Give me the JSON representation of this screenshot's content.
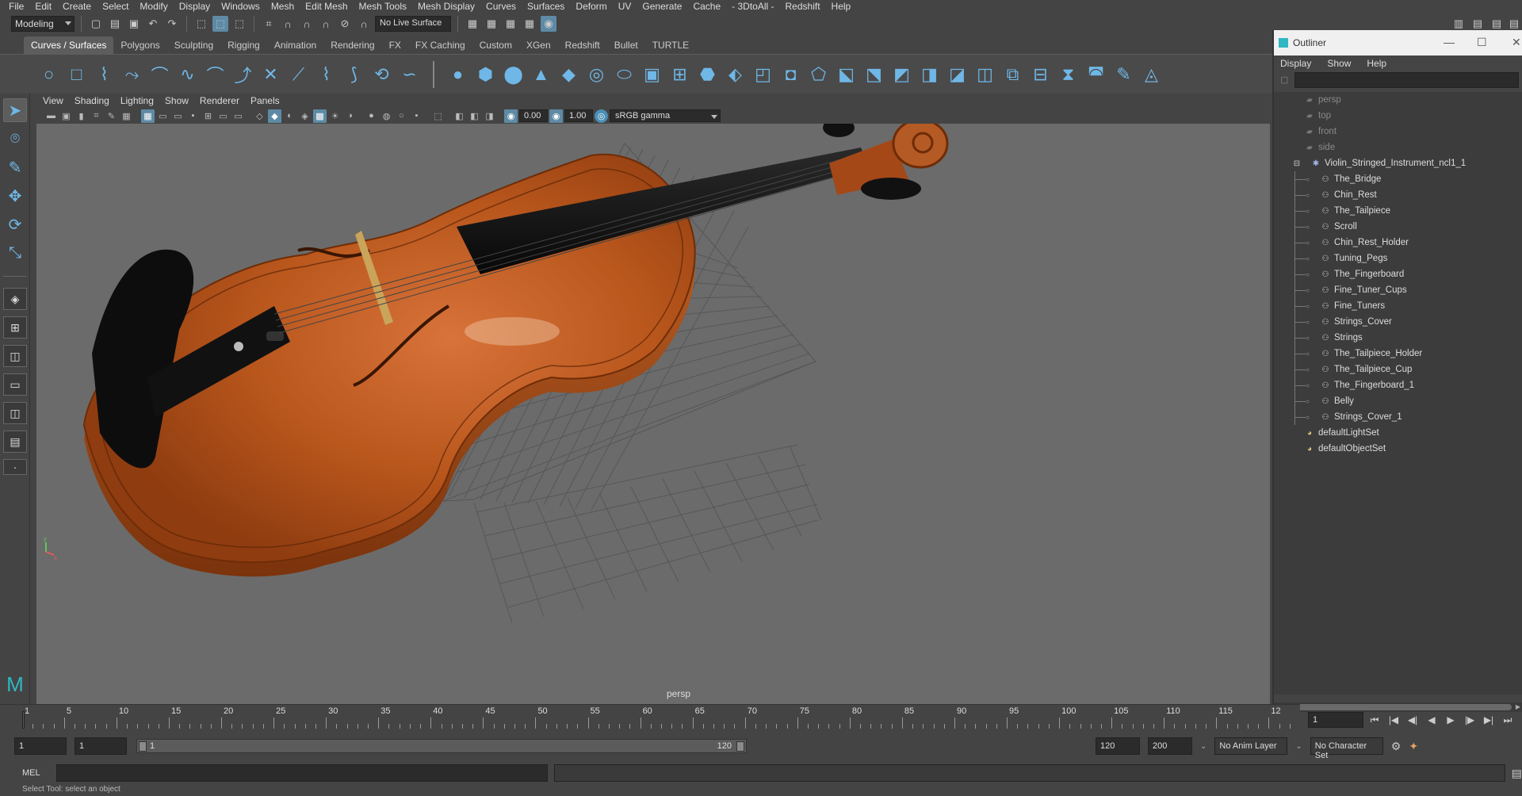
{
  "menubar": [
    "File",
    "Edit",
    "Create",
    "Select",
    "Modify",
    "Display",
    "Windows",
    "Mesh",
    "Edit Mesh",
    "Mesh Tools",
    "Mesh Display",
    "Curves",
    "Surfaces",
    "Deform",
    "UV",
    "Generate",
    "Cache",
    "- 3DtoAll -",
    "Redshift",
    "Help"
  ],
  "status_line": {
    "mode": "Modeling",
    "live_surface": "No Live Surface"
  },
  "shelf_tabs": [
    "Curves / Surfaces",
    "Polygons",
    "Sculpting",
    "Rigging",
    "Animation",
    "Rendering",
    "FX",
    "FX Caching",
    "Custom",
    "XGen",
    "Redshift",
    "Bullet",
    "TURTLE"
  ],
  "shelf_active_tab": "Curves / Surfaces",
  "shelf_icons": [
    "circle-icon",
    "square-icon",
    "cv-curve-icon",
    "ep-curve-icon",
    "pencil-curve-icon",
    "bezier-curve-icon",
    "arc-icon",
    "curve-tool-icon",
    "attach-curves-icon",
    "detach-curves-icon",
    "rebuild-curve-icon",
    "offset-curve-icon",
    "reverse-curve-icon",
    "bend-curve-icon",
    "sphere-icon",
    "cube-icon",
    "cylinder-icon",
    "cone-icon",
    "plane-icon",
    "torus-icon",
    "revolve-icon",
    "loft-icon",
    "planar-icon",
    "extrude-icon",
    "birail-icon",
    "boundary-icon",
    "square-surface-icon",
    "bevel-icon",
    "intersect-icon",
    "project-curve-icon",
    "trim-icon",
    "untrim-icon",
    "attach-surface-icon",
    "detach-surface-icon",
    "align-surface-icon",
    "open-close-icon",
    "insert-isoparm-icon",
    "rebuild-surface-icon",
    "sculpt-geometry-icon",
    "stitch-icon"
  ],
  "viewport": {
    "menus": [
      "View",
      "Shading",
      "Lighting",
      "Show",
      "Renderer",
      "Panels"
    ],
    "near_value": "0.00",
    "far_value": "1.00",
    "color_space": "sRGB gamma",
    "camera_label": "persp"
  },
  "outliner": {
    "title": "Outliner",
    "menus": [
      "Display",
      "Show",
      "Help"
    ],
    "cameras": [
      "persp",
      "top",
      "front",
      "side"
    ],
    "group": "Violin_Stringed_Instrument_ncl1_1",
    "children": [
      "The_Bridge",
      "Chin_Rest",
      "The_Tailpiece",
      "Scroll",
      "Chin_Rest_Holder",
      "Tuning_Pegs",
      "The_Fingerboard",
      "Fine_Tuner_Cups",
      "Fine_Tuners",
      "Strings_Cover",
      "Strings",
      "The_Tailpiece_Holder",
      "The_Tailpiece_Cup",
      "The_Fingerboard_1",
      "Belly",
      "Strings_Cover_1"
    ],
    "sets": [
      "defaultLightSet",
      "defaultObjectSet"
    ]
  },
  "timeline": {
    "ticks": [
      "1",
      "5",
      "10",
      "15",
      "20",
      "25",
      "30",
      "35",
      "40",
      "45",
      "50",
      "55",
      "60",
      "65",
      "70",
      "75",
      "80",
      "85",
      "90",
      "95",
      "100",
      "105",
      "110",
      "115",
      "12"
    ],
    "current_frame": "1"
  },
  "range": {
    "start": "1",
    "anim_start": "1",
    "slider_start": "1",
    "slider_end": "120",
    "end": "120",
    "anim_end": "200",
    "anim_layer": "No Anim Layer",
    "character_set": "No Character Set"
  },
  "command_line": {
    "language": "MEL",
    "help_text": "Select Tool: select an object"
  },
  "colors": {
    "accent": "#5e8aa5",
    "shelf_icon": "#6fb7e6",
    "violin_body": "#b8561c",
    "fingerboard": "#151515"
  }
}
